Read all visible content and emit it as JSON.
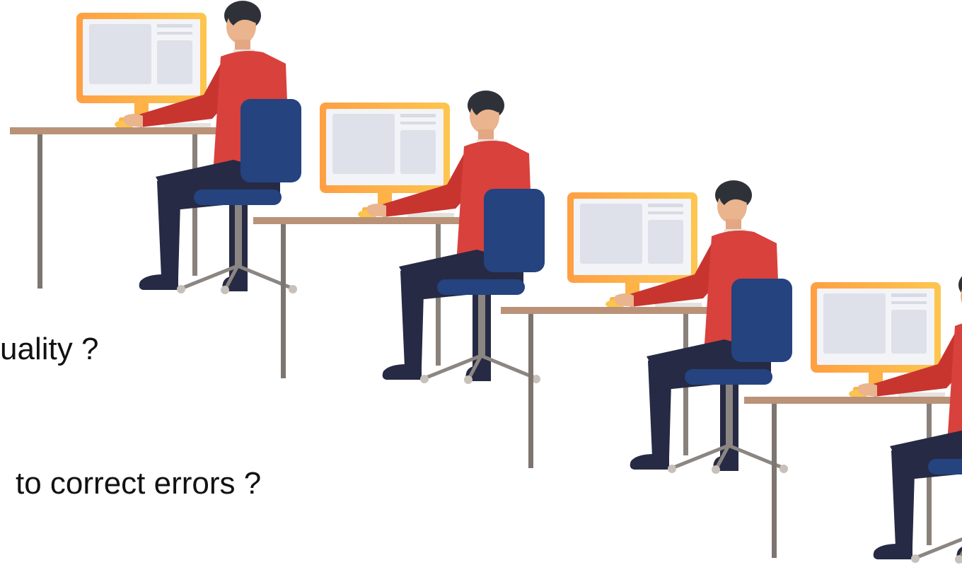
{
  "slide": {
    "lines": [
      "uality ?",
      "to correct errors ?"
    ]
  },
  "illustration": {
    "figure_count": 4,
    "colors": {
      "shirt": "#D9413D",
      "pants": "#262A44",
      "chair": "#24437F",
      "hair": "#2E3238",
      "skin": "#E9B48E",
      "monitor_frame": "#FDB347",
      "screen": "#F3F4F8",
      "panel": "#DEE1E9",
      "desk_top": "#B99278",
      "desk_leg": "#7D7570",
      "chair_post": "#8C8682",
      "caster": "#C7C0BB"
    }
  }
}
